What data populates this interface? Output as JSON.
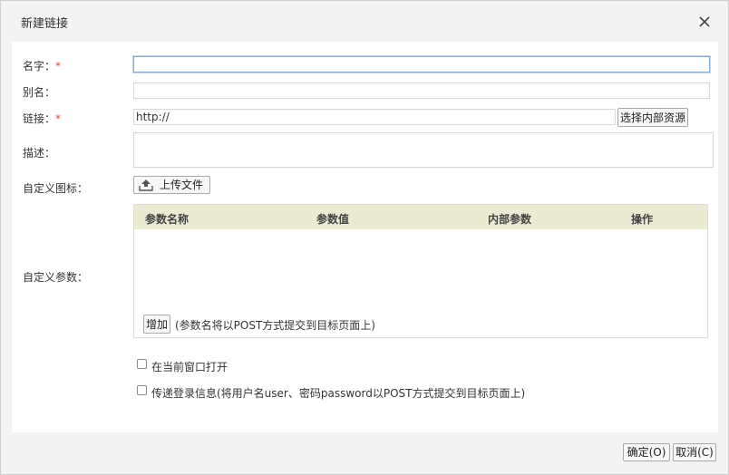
{
  "dialog": {
    "title": "新建链接",
    "close_icon": "close-icon"
  },
  "form": {
    "name": {
      "label": "名字：",
      "required_mark": "*",
      "value": ""
    },
    "alias": {
      "label": "别名：",
      "value": ""
    },
    "link": {
      "label": "链接：",
      "required_mark": "*",
      "value": "http://",
      "select_resource_label": "选择内部资源"
    },
    "description": {
      "label": "描述：",
      "value": ""
    },
    "custom_icon": {
      "label": "自定义图标：",
      "upload_label": "上传文件",
      "upload_icon": "upload-icon"
    },
    "custom_params": {
      "label": "自定义参数：",
      "columns": [
        "参数名称",
        "参数值",
        "内部参数",
        "操作"
      ],
      "add_label": "增加",
      "hint": "(参数名将以POST方式提交到目标页面上)"
    },
    "open_in_current_window": {
      "label": "在当前窗口打开",
      "checked": false
    },
    "pass_login_info": {
      "label": "传递登录信息(将用户名user、密码password以POST方式提交到目标页面上)",
      "checked": false
    }
  },
  "footer": {
    "ok_label": "确定(O)",
    "cancel_label": "取消(C)"
  },
  "colors": {
    "required": "#e74c3c",
    "table_header": "#ebebd3",
    "focus_border": "#7fa8d9"
  }
}
